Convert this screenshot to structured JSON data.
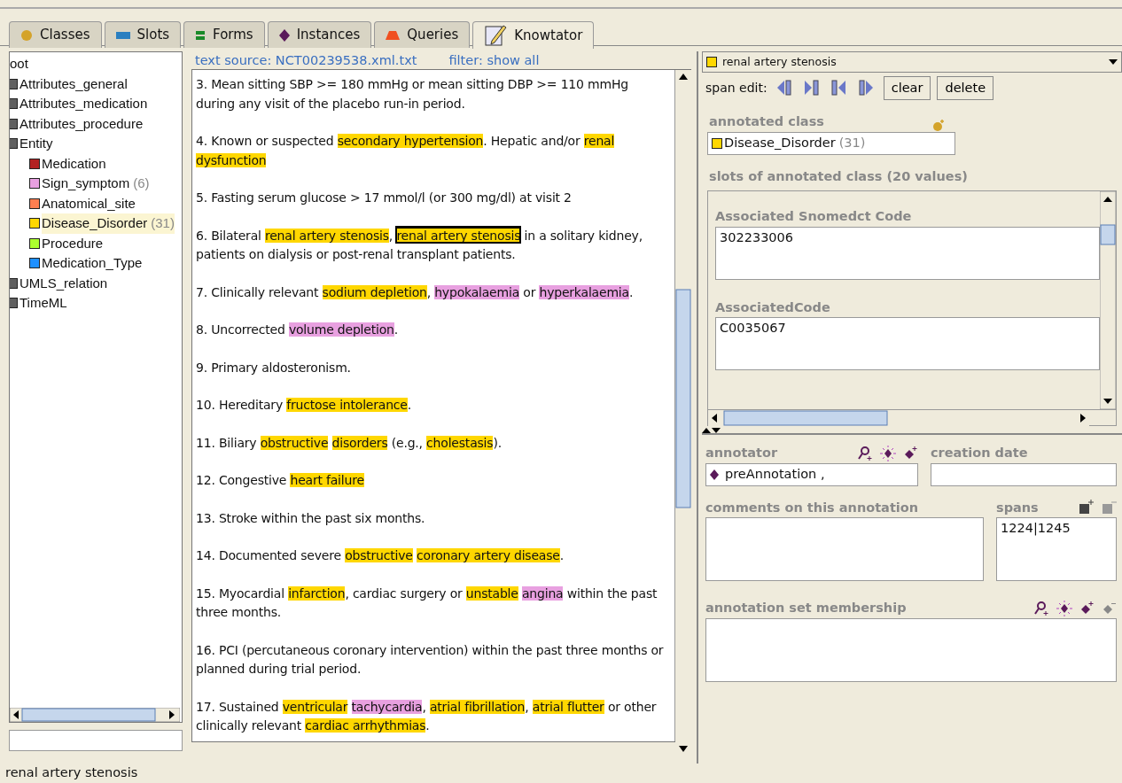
{
  "tabs": [
    {
      "label": "Classes",
      "selected": false
    },
    {
      "label": "Slots",
      "selected": false
    },
    {
      "label": "Forms",
      "selected": false
    },
    {
      "label": "Instances",
      "selected": false
    },
    {
      "label": "Queries",
      "selected": false
    },
    {
      "label": "Knowtator",
      "selected": true
    }
  ],
  "class_tree": {
    "root": "oot",
    "items": [
      {
        "label": "Attributes_general",
        "color": "#606060",
        "selected": false
      },
      {
        "label": "Attributes_medication",
        "color": "#606060",
        "selected": false
      },
      {
        "label": "Attributes_procedure",
        "color": "#606060",
        "selected": false
      },
      {
        "label": "Entity",
        "color": "#606060",
        "selected": false,
        "children": [
          {
            "label": "Medication",
            "color": "#b22222",
            "selected": false
          },
          {
            "label": "Sign_symptom",
            "count": "(6)",
            "color": "#e8a0e0",
            "selected": false
          },
          {
            "label": "Anatomical_site",
            "color": "#ff7f50",
            "selected": false
          },
          {
            "label": "Disease_Disorder",
            "count": "(31)",
            "color": "#ffd700",
            "selected": true
          },
          {
            "label": "Procedure",
            "color": "#adff2f",
            "selected": false
          },
          {
            "label": "Medication_Type",
            "color": "#1e90ff",
            "selected": false
          }
        ]
      },
      {
        "label": "UMLS_relation",
        "color": "#606060",
        "selected": false
      },
      {
        "label": "TimeML",
        "color": "#606060",
        "selected": false
      }
    ]
  },
  "text_source": {
    "label": "text source: NCT00239538.xml.txt",
    "filter": "filter: show all"
  },
  "paragraphs": [
    [
      {
        "text": "3. Mean sitting SBP >= 180 mmHg or mean sitting DBP >= 110 mmHg during any visit of the placebo run-in period."
      }
    ],
    [
      {
        "text": "4. Known or suspected "
      },
      {
        "text": "secondary hypertension",
        "color": "#ffd700",
        "selected": false
      },
      {
        "text": ". Hepatic and/or "
      },
      {
        "text": "renal dysfunction",
        "color": "#ffd700",
        "selected": false
      }
    ],
    [
      {
        "text": "5. Fasting serum glucose > 17 mmol/l (or 300 mg/dl) at visit 2"
      }
    ],
    [
      {
        "text": "6. Bilateral "
      },
      {
        "text": "renal artery stenosis",
        "color": "#ffd700",
        "selected": false
      },
      {
        "text": ", "
      },
      {
        "text": "renal artery stenosis",
        "color": "#ffd700",
        "selected": true
      },
      {
        "text": " in a solitary kidney, patients on dialysis or post-renal transplant patients."
      }
    ],
    [
      {
        "text": "7. Clinically relevant "
      },
      {
        "text": "sodium depletion",
        "color": "#ffd700",
        "selected": false
      },
      {
        "text": ", "
      },
      {
        "text": "hypokalaemia",
        "color": "#e8a0e0",
        "selected": false
      },
      {
        "text": " or "
      },
      {
        "text": "hyperkalaemia",
        "color": "#e8a0e0",
        "selected": false
      },
      {
        "text": "."
      }
    ],
    [
      {
        "text": "8. Uncorrected "
      },
      {
        "text": "volume depletion",
        "color": "#e8a0e0",
        "selected": false
      },
      {
        "text": "."
      }
    ],
    [
      {
        "text": "9. Primary aldosteronism."
      }
    ],
    [
      {
        "text": "10. Hereditary "
      },
      {
        "text": "fructose intolerance",
        "color": "#ffd700",
        "selected": false
      },
      {
        "text": "."
      }
    ],
    [
      {
        "text": "11. Biliary "
      },
      {
        "text": "obstructive",
        "color": "#ffd700",
        "selected": false
      },
      {
        "text": "disorders",
        "color": "#ffd700",
        "selected": false
      },
      {
        "text": " (e.g., "
      },
      {
        "text": "cholestasis",
        "color": "#ffd700",
        "selected": false
      },
      {
        "text": ")."
      }
    ],
    [
      {
        "text": "12. Congestive "
      },
      {
        "text": "heart failure",
        "color": "#ffd700",
        "selected": false
      }
    ],
    [
      {
        "text": "13. Stroke within the past six months."
      }
    ],
    [
      {
        "text": "14. Documented severe "
      },
      {
        "text": "obstructive",
        "color": "#ffd700",
        "selected": false
      },
      {
        "text": "coronary artery disease",
        "color": "#ffd700",
        "selected": false
      },
      {
        "text": "."
      }
    ],
    [
      {
        "text": "15. Myocardial "
      },
      {
        "text": "infarction",
        "color": "#ffd700",
        "selected": false
      },
      {
        "text": ", cardiac surgery or "
      },
      {
        "text": "unstable",
        "color": "#ffd700",
        "selected": false
      },
      {
        "text": "angina",
        "color": "#e8a0e0",
        "selected": false
      },
      {
        "text": " within the past three months."
      }
    ],
    [
      {
        "text": "16. PCI (percutaneous coronary intervention) within the past three months or planned during trial period."
      }
    ],
    [
      {
        "text": "17. Sustained "
      },
      {
        "text": "ventricular",
        "color": "#ffd700",
        "selected": false
      },
      {
        "text": "tachycardia",
        "color": "#e8a0e0",
        "selected": false
      },
      {
        "text": ", "
      },
      {
        "text": "atrial fibrillation",
        "color": "#ffd700",
        "selected": false
      },
      {
        "text": ", "
      },
      {
        "text": "atrial flutter",
        "color": "#ffd700",
        "selected": false
      },
      {
        "text": " or other clinically relevant "
      },
      {
        "text": "cardiac arrhythmias",
        "color": "#ffd700",
        "selected": false
      },
      {
        "text": "."
      }
    ]
  ],
  "annotation": {
    "title": "renal artery stenosis",
    "color": "#ffd700",
    "span_edit_label": "span edit:",
    "buttons": [
      "clear",
      "delete"
    ],
    "annotated_class_label": "annotated class",
    "annotated_class": {
      "label": "Disease_Disorder",
      "count": "(31)",
      "color": "#ffd700"
    },
    "slots_label": "slots of annotated class (20 values)",
    "slots": [
      {
        "label": "Associated Snomedct Code",
        "value": "302233006"
      },
      {
        "label": "AssociatedCode",
        "value": "C0035067"
      }
    ],
    "annotator_label": "annotator",
    "annotator": "preAnnotation ,",
    "creation_date_label": "creation date",
    "comments_label": "comments on this annotation",
    "spans_label": "spans",
    "spans": "1224|1245",
    "set_membership_label": "annotation set membership"
  },
  "status_bar": "renal artery stenosis"
}
